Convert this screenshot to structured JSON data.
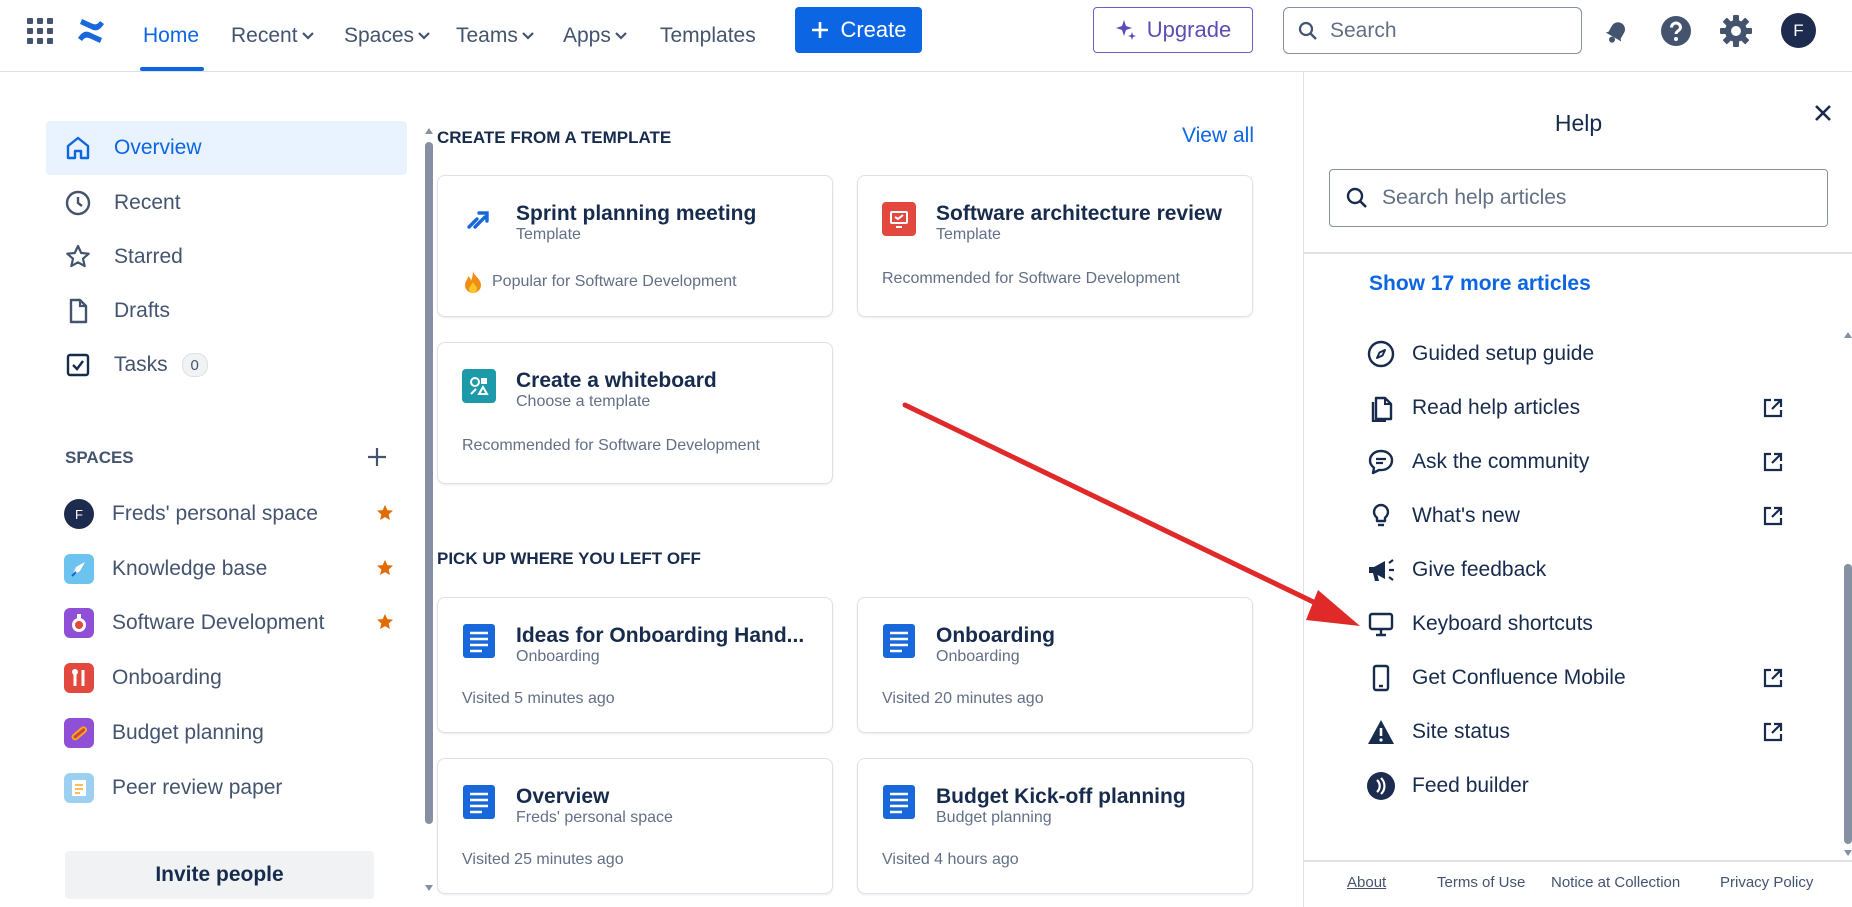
{
  "topnav": {
    "items": [
      {
        "label": "Home"
      },
      {
        "label": "Recent"
      },
      {
        "label": "Spaces"
      },
      {
        "label": "Teams"
      },
      {
        "label": "Apps"
      },
      {
        "label": "Templates"
      }
    ],
    "create_label": "Create",
    "upgrade_label": "Upgrade",
    "search_placeholder": "Search",
    "avatar_initial": "F"
  },
  "sidebar": {
    "items": [
      {
        "label": "Overview"
      },
      {
        "label": "Recent"
      },
      {
        "label": "Starred"
      },
      {
        "label": "Drafts"
      },
      {
        "label": "Tasks",
        "badge": "0"
      }
    ],
    "spaces_heading": "SPACES",
    "spaces": [
      {
        "label": "Freds' personal space",
        "avatar": "F"
      },
      {
        "label": "Knowledge base"
      },
      {
        "label": "Software Development"
      },
      {
        "label": "Onboarding"
      },
      {
        "label": "Budget planning"
      },
      {
        "label": "Peer review paper"
      }
    ],
    "invite_label": "Invite people"
  },
  "main": {
    "templates_heading": "CREATE FROM A TEMPLATE",
    "view_all": "View all",
    "templates": [
      {
        "title": "Sprint planning meeting",
        "subtitle": "Template",
        "footer": "Popular for Software Development"
      },
      {
        "title": "Software architecture review",
        "subtitle": "Template",
        "footer": "Recommended for Software Development"
      },
      {
        "title": "Create a whiteboard",
        "subtitle": "Choose a template",
        "footer": "Recommended for Software Development"
      }
    ],
    "recent_heading": "PICK UP WHERE YOU LEFT OFF",
    "recent": [
      {
        "title": "Ideas for Onboarding Hand...",
        "subtitle": "Onboarding",
        "footer": "Visited 5 minutes ago"
      },
      {
        "title": "Onboarding",
        "subtitle": "Onboarding",
        "footer": "Visited 20 minutes ago"
      },
      {
        "title": "Overview",
        "subtitle": "Freds' personal space",
        "footer": "Visited 25 minutes ago"
      },
      {
        "title": "Budget Kick-off planning",
        "subtitle": "Budget planning",
        "footer": "Visited 4 hours ago"
      }
    ]
  },
  "help": {
    "title": "Help",
    "search_placeholder": "Search help articles",
    "show_more": "Show 17 more articles",
    "items": [
      {
        "label": "Guided setup guide",
        "icon": "compass-icon"
      },
      {
        "label": "Read help articles",
        "icon": "documents-icon"
      },
      {
        "label": "Ask the community",
        "icon": "chat-icon"
      },
      {
        "label": "What's new",
        "icon": "lightbulb-icon"
      },
      {
        "label": "Give feedback",
        "icon": "megaphone-icon"
      },
      {
        "label": "Keyboard shortcuts",
        "icon": "monitor-icon"
      },
      {
        "label": "Get Confluence Mobile",
        "icon": "mobile-icon"
      },
      {
        "label": "Site status",
        "icon": "warning-icon"
      },
      {
        "label": "Feed builder",
        "icon": "feed-icon"
      }
    ],
    "footer": {
      "about": "About",
      "terms": "Terms of Use",
      "notice": "Notice at Collection",
      "privacy": "Privacy Policy"
    }
  },
  "colors": {
    "primary": "#0C66E4",
    "upgrade": "#5E4DB2",
    "annotation_arrow": "#E02A2A",
    "star": "#E06C00"
  }
}
